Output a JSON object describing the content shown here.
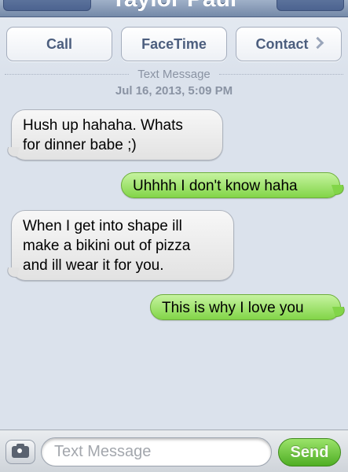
{
  "header": {
    "title": "Taylor Paul"
  },
  "actions": {
    "call_label": "Call",
    "facetime_label": "FaceTime",
    "contact_label": "Contact"
  },
  "thread": {
    "type_label": "Text Message",
    "timestamp": "Jul 16, 2013, 5:09 PM",
    "messages": [
      {
        "direction": "incoming",
        "lines": [
          "Hush up hahaha. Whats",
          "for dinner babe ;)"
        ]
      },
      {
        "direction": "outgoing",
        "lines": [
          "Uhhhh I don't know haha"
        ]
      },
      {
        "direction": "incoming",
        "lines": [
          "When I get into shape ill",
          "make a bikini out of pizza",
          "and ill wear it for you."
        ]
      },
      {
        "direction": "outgoing",
        "lines": [
          "This is why I love you"
        ]
      }
    ]
  },
  "composer": {
    "placeholder": "Text Message",
    "value": "",
    "send_label": "Send",
    "camera_icon": "camera-icon"
  },
  "colors": {
    "incoming_bubble": "#e9e9e9",
    "outgoing_bubble": "#82d548",
    "background": "#dbe2ec",
    "send_button": "#4fae24"
  }
}
